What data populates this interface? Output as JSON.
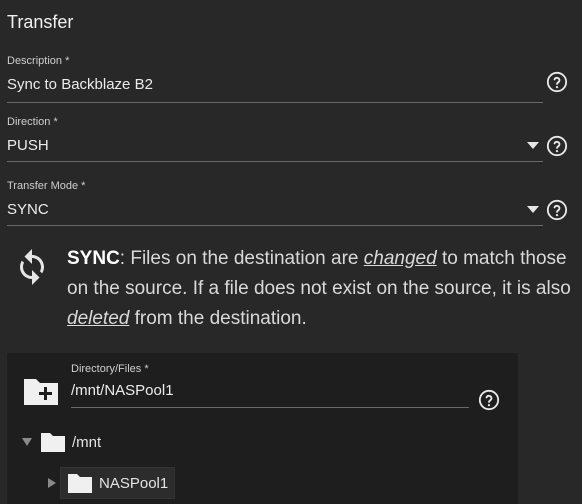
{
  "section": {
    "title": "Transfer"
  },
  "description": {
    "label": "Description *",
    "value": "Sync to Backblaze B2"
  },
  "direction": {
    "label": "Direction *",
    "value": "PUSH"
  },
  "transfer_mode": {
    "label": "Transfer Mode *",
    "value": "SYNC"
  },
  "sync_info": {
    "mode": "SYNC",
    "text_1": ": Files on the destination are ",
    "changed": "changed",
    "text_2": " to match those on the source. If a file does not exist on the source, it is also ",
    "deleted": "deleted",
    "text_3": " from the destination."
  },
  "explorer": {
    "label": "Directory/Files *",
    "value": "/mnt/NASPool1",
    "tree": [
      {
        "label": "/mnt",
        "expanded": true
      },
      {
        "label": "NASPool1",
        "expanded": false
      }
    ]
  },
  "icons": {
    "help": "help-circle-icon",
    "sync": "sync-icon",
    "add_folder": "folder-plus-icon",
    "folder": "folder-icon",
    "caret": "dropdown-caret-icon"
  },
  "colors": {
    "background": "#282828",
    "explorer_bg": "#1e1e1e",
    "text": "#e8e8e8",
    "underline": "#6a6a6a"
  }
}
